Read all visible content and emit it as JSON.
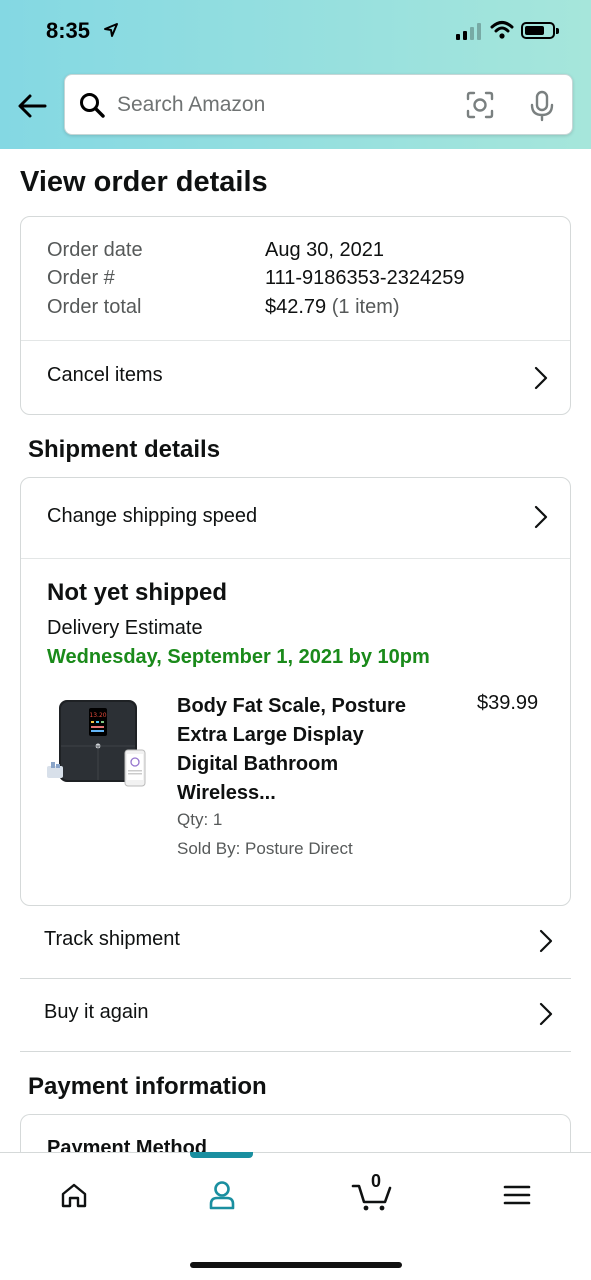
{
  "status_bar": {
    "time": "8:35"
  },
  "search": {
    "placeholder": "Search Amazon"
  },
  "page": {
    "title": "View order details"
  },
  "order": {
    "date_label": "Order date",
    "date_value": "Aug 30, 2021",
    "number_label": "Order #",
    "number_value": "111-9186353-2324259",
    "total_label": "Order total",
    "total_value": "$42.79",
    "total_items": "(1 item)",
    "cancel_label": "Cancel items"
  },
  "shipment": {
    "section_title": "Shipment details",
    "change_speed_label": "Change shipping speed",
    "status": "Not yet shipped",
    "estimate_label": "Delivery Estimate",
    "estimate_date": "Wednesday, September 1, 2021 by 10pm",
    "estimate_color": "#1a8a1a",
    "product": {
      "title_line1": "Body Fat Scale, Posture",
      "title_line2": "Extra Large Display",
      "title_line3": "Digital Bathroom",
      "title_line4": "Wireless...",
      "price": "$39.99",
      "qty": "Qty: 1",
      "seller": "Sold By: Posture Direct",
      "display_reading": "13.20"
    },
    "track_label": "Track shipment",
    "buy_again_label": "Buy it again"
  },
  "payment": {
    "section_title": "Payment information",
    "method_label": "Payment Method"
  },
  "bottom_nav": {
    "items": [
      "home-icon",
      "account-icon",
      "cart-icon",
      "menu-icon"
    ],
    "active": "account-icon",
    "cart_count": "0",
    "accent_color": "#1a8fa0"
  }
}
